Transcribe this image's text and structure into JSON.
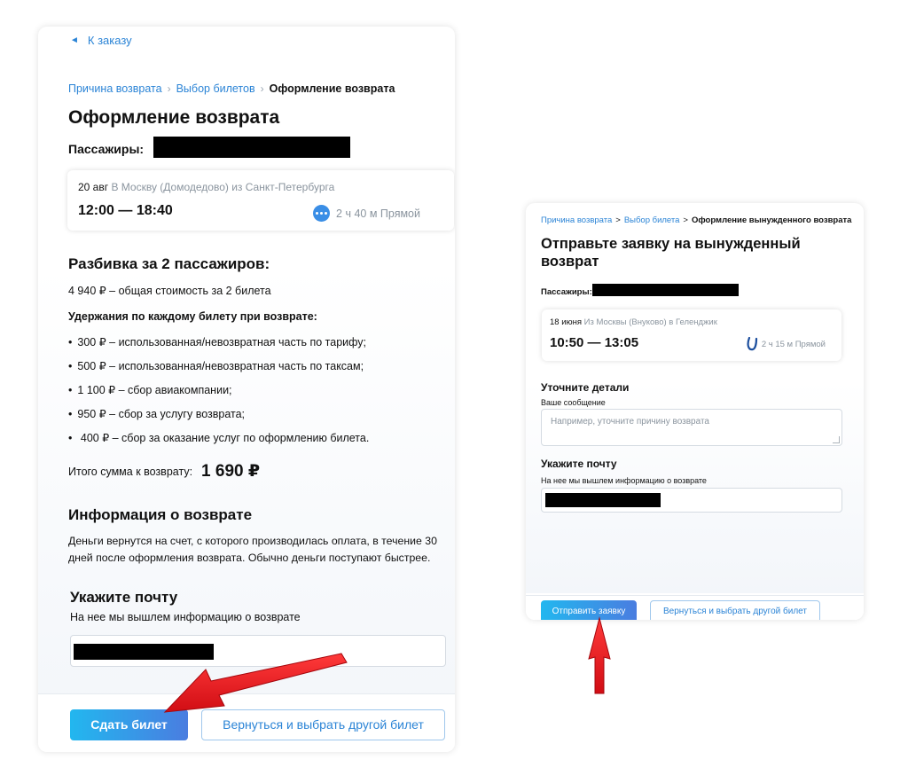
{
  "left": {
    "back_label": "К заказу",
    "breadcrumb": [
      "Причина возврата",
      "Выбор билетов",
      "Оформление возврата"
    ],
    "title": "Оформление возврата",
    "passengers_label": "Пассажиры:",
    "flight": {
      "date": "20 авг",
      "route": "В Москву (Домодедово) из Санкт-Петербурга",
      "time": "12:00 — 18:40",
      "duration": "2 ч 40 м Прямой",
      "airline_icon": "airline-dots-icon"
    },
    "breakdown_title": "Разбивка за 2 пассажиров:",
    "total_cost": "4 940 ₽  – общая стоимость за 2 билета",
    "deductions_title": "Удержания по каждому билету при возврате:",
    "deductions": [
      "300 ₽  – использованная/невозвратная часть по тарифу;",
      "500 ₽  – использованная/невозвратная часть по таксам;",
      "1 100 ₽  – сбор авиакомпании;",
      "950 ₽  – сбор за услугу возврата;",
      " 400 ₽  – сбор за оказание услуг по оформлению билета."
    ],
    "refund_label": "Итого сумма к возврату:",
    "refund_value": "1 690 ₽",
    "info_title": "Информация о возврате",
    "info_text": "Деньги вернутся на счет, с которого производилась оплата, в течение 30 дней после оформления возврата.  Обычно деньги поступают быстрее.",
    "email_title": "Укажите почту",
    "email_hint": "На нее мы вышлем информацию о возврате",
    "submit_label": "Сдать билет",
    "back_button_label": "Вернуться и выбрать другой билет"
  },
  "right": {
    "breadcrumb": [
      "Причина возврата",
      "Выбор билета",
      "Оформление вынужденного возврата"
    ],
    "title": "Отправьте заявку на вынужденный возврат",
    "passengers_label": "Пассажиры:",
    "flight": {
      "date": "18 июня",
      "route": "Из Москвы (Внуково) в Геленджик",
      "time": "10:50 — 13:05",
      "duration": "2 ч 15 м Прямой",
      "airline_icon": "airline-swoosh-icon"
    },
    "details_title": "Уточните детали",
    "message_label": "Ваше сообщение",
    "message_placeholder": "Например, уточните причину возврата",
    "email_title": "Укажите почту",
    "email_hint": "На нее мы вышлем информацию о возврате",
    "submit_label": "Отправить заявку",
    "back_button_label": "Вернуться и выбрать другой билет"
  },
  "colors": {
    "link": "#2b84d6",
    "button_gradient_start": "#22b7ef",
    "button_gradient_end": "#4a7de0",
    "arrow": "#ee1c24"
  }
}
